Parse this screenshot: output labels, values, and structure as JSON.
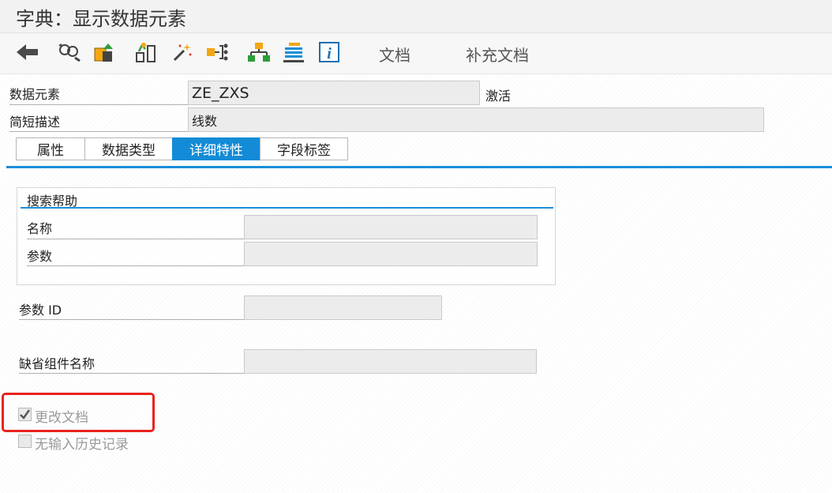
{
  "window": {
    "title": "字典：显示数据元素"
  },
  "toolbar": {
    "icons": [
      {
        "name": "back-arrow-icon"
      },
      {
        "name": "display-change-icon"
      },
      {
        "name": "check-object-icon"
      },
      {
        "name": "activate-icon"
      },
      {
        "name": "wand-icon"
      },
      {
        "name": "where-used-icon"
      },
      {
        "name": "hierarchy-icon"
      },
      {
        "name": "list-icon"
      },
      {
        "name": "info-icon"
      }
    ],
    "doc_label": "文档",
    "supp_doc_label": "补充文档"
  },
  "header": {
    "data_element_label": "数据元素",
    "data_element_value": "ZE_ZXS",
    "status": "激活",
    "short_desc_label": "简短描述",
    "short_desc_value": "线数"
  },
  "tabs": [
    {
      "label": "属性",
      "active": false
    },
    {
      "label": "数据类型",
      "active": false
    },
    {
      "label": "详细特性",
      "active": true
    },
    {
      "label": "字段标签",
      "active": false
    }
  ],
  "search_help": {
    "title": "搜索帮助",
    "name_label": "名称",
    "name_value": "",
    "param_label": "参数",
    "param_value": ""
  },
  "param_id": {
    "label": "参数 ID",
    "value": ""
  },
  "default_component": {
    "label": "缺省组件名称",
    "value": ""
  },
  "checkboxes": [
    {
      "label": "更改文档",
      "checked": true
    },
    {
      "label": "无输入历史记录",
      "checked": false
    }
  ],
  "colors": {
    "accent": "#138bd6",
    "highlight": "#e8231d"
  }
}
